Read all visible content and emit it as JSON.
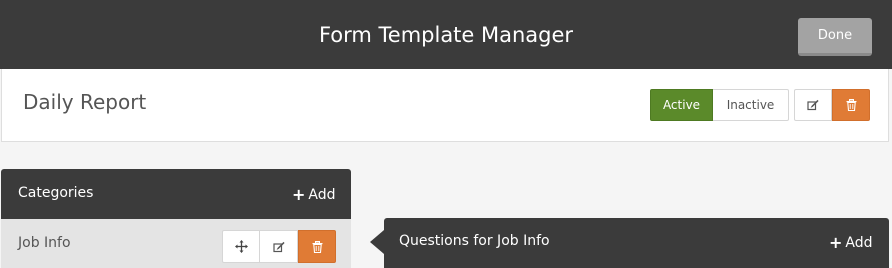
{
  "header": {
    "title": "Form Template Manager",
    "done_label": "Done"
  },
  "template": {
    "name": "Daily Report",
    "status_active_label": "Active",
    "status_inactive_label": "Inactive",
    "selected_status": "Active",
    "edit_icon": "pencil-square-icon",
    "delete_icon": "trash-icon"
  },
  "categories": {
    "title": "Categories",
    "add_label": "Add",
    "items": [
      {
        "label": "Job Info",
        "icons": [
          "move-arrows-icon",
          "pencil-square-icon",
          "trash-icon"
        ]
      }
    ]
  },
  "questions": {
    "title": "Questions for Job Info",
    "add_label": "Add"
  },
  "colors": {
    "dark_bar": "#3b3b3b",
    "active_green": "#5b8a2a",
    "delete_orange": "#e07b35",
    "done_gray": "#a3a3a3"
  }
}
